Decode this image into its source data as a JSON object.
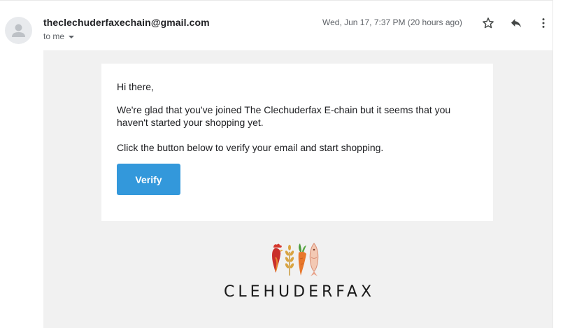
{
  "header": {
    "sender": "theclechuderfaxechain@gmail.com",
    "recipient": "to me",
    "date": "Wed, Jun 17, 7:37 PM (20 hours ago)"
  },
  "icons": {
    "avatar": "person-icon",
    "star": "star-icon",
    "reply": "reply-icon",
    "more": "more-vert-icon",
    "recipient_dropdown": "caret-down-icon"
  },
  "email": {
    "greeting": "Hi there,",
    "paragraph1": "We're glad that you've joined The Clechuderfax E-chain but it seems that you haven't started your shopping yet.",
    "paragraph2": "Click the button below to verify your email and start shopping.",
    "verify_label": "Verify"
  },
  "footer": {
    "brand": "CLEHUDERFAX"
  },
  "colors": {
    "button": "#3398db",
    "panel_background": "#f1f1f1"
  }
}
